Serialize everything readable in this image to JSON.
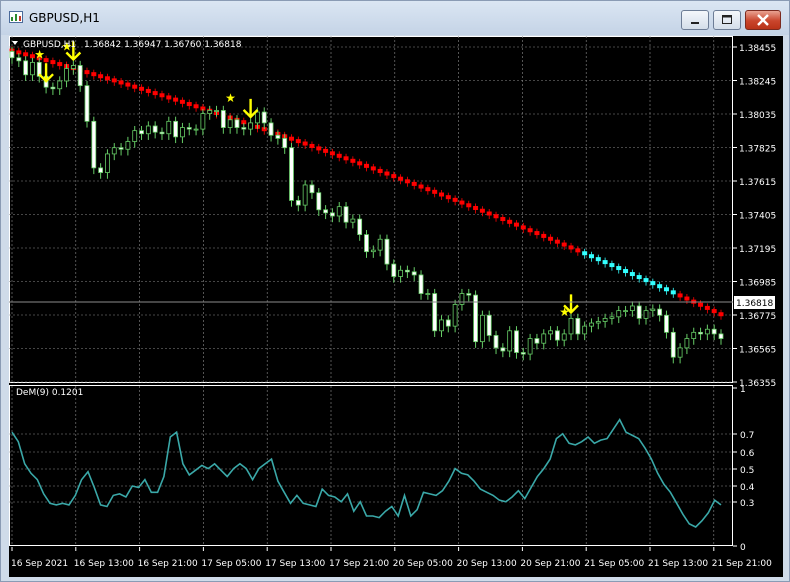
{
  "window": {
    "title": "GBPUSD,H1",
    "controls": [
      "minimize",
      "maximize",
      "close"
    ]
  },
  "chart_header": {
    "symbol": "GBPUSD,H1",
    "ohlc": "1.36842 1.36947 1.36760 1.36818"
  },
  "price_axis": {
    "ticks": [
      "1.38455",
      "1.38245",
      "1.38035",
      "1.37825",
      "1.37615",
      "1.37405",
      "1.37195",
      "1.36985",
      "1.36775",
      "1.36565",
      "1.36355"
    ],
    "current_price": "1.36818"
  },
  "indicator": {
    "label": "DeM(9) 0.1201",
    "axis_ticks": [
      "1",
      "0.7",
      "0.6",
      "0.5",
      "0.4",
      "0.3",
      "0"
    ]
  },
  "time_axis": {
    "ticks": [
      "16 Sep 2021",
      "16 Sep 13:00",
      "16 Sep 21:00",
      "17 Sep 05:00",
      "17 Sep 13:00",
      "17 Sep 21:00",
      "20 Sep 05:00",
      "20 Sep 13:00",
      "20 Sep 21:00",
      "21 Sep 05:00",
      "21 Sep 13:00",
      "21 Sep 21:00"
    ]
  },
  "colors": {
    "background": "#000000",
    "grid": "#8c8c8c",
    "bull_candle": "#ccffcc",
    "bear_candle": "#ffffff",
    "wick": "#66cc66",
    "trend_dots_down": "#ff0000",
    "trend_dots_up": "#33ffff",
    "signal_arrow": "#ffff00",
    "indicator_line": "#3aa8a8",
    "text": "#ffffff"
  },
  "chart_data": {
    "type": "candlestick",
    "ylim": [
      1.3632,
      1.3855
    ],
    "close": [
      1.3841,
      1.3839,
      1.383,
      1.3838,
      1.3829,
      1.3822,
      1.3821,
      1.3826,
      1.3834,
      1.3836,
      1.3823,
      1.38,
      1.377,
      1.3767,
      1.3779,
      1.3783,
      1.3782,
      1.3787,
      1.3794,
      1.3792,
      1.3797,
      1.3793,
      1.3792,
      1.38,
      1.379,
      1.3796,
      1.3795,
      1.3795,
      1.3805,
      1.3807,
      1.3807,
      1.3796,
      1.3801,
      1.3796,
      1.3795,
      1.3799,
      1.3806,
      1.3799,
      1.3791,
      1.3789,
      1.3783,
      1.3749,
      1.3746,
      1.3759,
      1.3754,
      1.3743,
      1.3741,
      1.3739,
      1.3745,
      1.3735,
      1.3737,
      1.3727,
      1.3716,
      1.3717,
      1.3724,
      1.3708,
      1.37,
      1.3704,
      1.3703,
      1.3701,
      1.3689,
      1.3689,
      1.3665,
      1.3672,
      1.3668,
      1.3682,
      1.3689,
      1.3688,
      1.3658,
      1.3675,
      1.3662,
      1.3654,
      1.3652,
      1.3665,
      1.3651,
      1.365,
      1.366,
      1.3657,
      1.3663,
      1.3665,
      1.3659,
      1.3663,
      1.3673,
      1.3663,
      1.3668,
      1.367,
      1.3671,
      1.3673,
      1.3674,
      1.3678,
      1.3678,
      1.3681,
      1.3673,
      1.3678,
      1.3679,
      1.3675,
      1.3664,
      1.3648,
      1.3654,
      1.366,
      1.3664,
      1.3663,
      1.3666,
      1.3663,
      1.366
    ],
    "trend_line": {
      "up_segment_index_range": [
        84,
        97
      ],
      "up_segment_last_index": 97
    },
    "signals": [
      {
        "type": "star",
        "index": 4
      },
      {
        "type": "arrow-down",
        "index": 5
      },
      {
        "type": "star",
        "index": 8
      },
      {
        "type": "arrow-down",
        "index": 9
      },
      {
        "type": "star",
        "index": 32
      },
      {
        "type": "arrow-down",
        "index": 35
      },
      {
        "type": "star",
        "index": 81
      },
      {
        "type": "arrow-down",
        "index": 82
      }
    ],
    "indicator_values": [
      0.72,
      0.66,
      0.52,
      0.46,
      0.42,
      0.33,
      0.27,
      0.26,
      0.27,
      0.26,
      0.32,
      0.42,
      0.47,
      0.37,
      0.26,
      0.25,
      0.32,
      0.33,
      0.31,
      0.38,
      0.37,
      0.42,
      0.34,
      0.34,
      0.44,
      0.69,
      0.72,
      0.52,
      0.45,
      0.48,
      0.51,
      0.49,
      0.52,
      0.48,
      0.44,
      0.49,
      0.52,
      0.49,
      0.42,
      0.49,
      0.52,
      0.55,
      0.41,
      0.34,
      0.27,
      0.32,
      0.27,
      0.26,
      0.25,
      0.36,
      0.32,
      0.31,
      0.28,
      0.33,
      0.22,
      0.28,
      0.19,
      0.19,
      0.18,
      0.22,
      0.25,
      0.19,
      0.32,
      0.19,
      0.23,
      0.34,
      0.33,
      0.32,
      0.35,
      0.41,
      0.49,
      0.46,
      0.45,
      0.41,
      0.36,
      0.34,
      0.32,
      0.29,
      0.28,
      0.31,
      0.35,
      0.3,
      0.37,
      0.44,
      0.49,
      0.55,
      0.68,
      0.71,
      0.65,
      0.64,
      0.66,
      0.69,
      0.65,
      0.67,
      0.68,
      0.74,
      0.8,
      0.72,
      0.7,
      0.68,
      0.62,
      0.55,
      0.46,
      0.39,
      0.34,
      0.27,
      0.2,
      0.14,
      0.12,
      0.16,
      0.21,
      0.29,
      0.26
    ]
  }
}
